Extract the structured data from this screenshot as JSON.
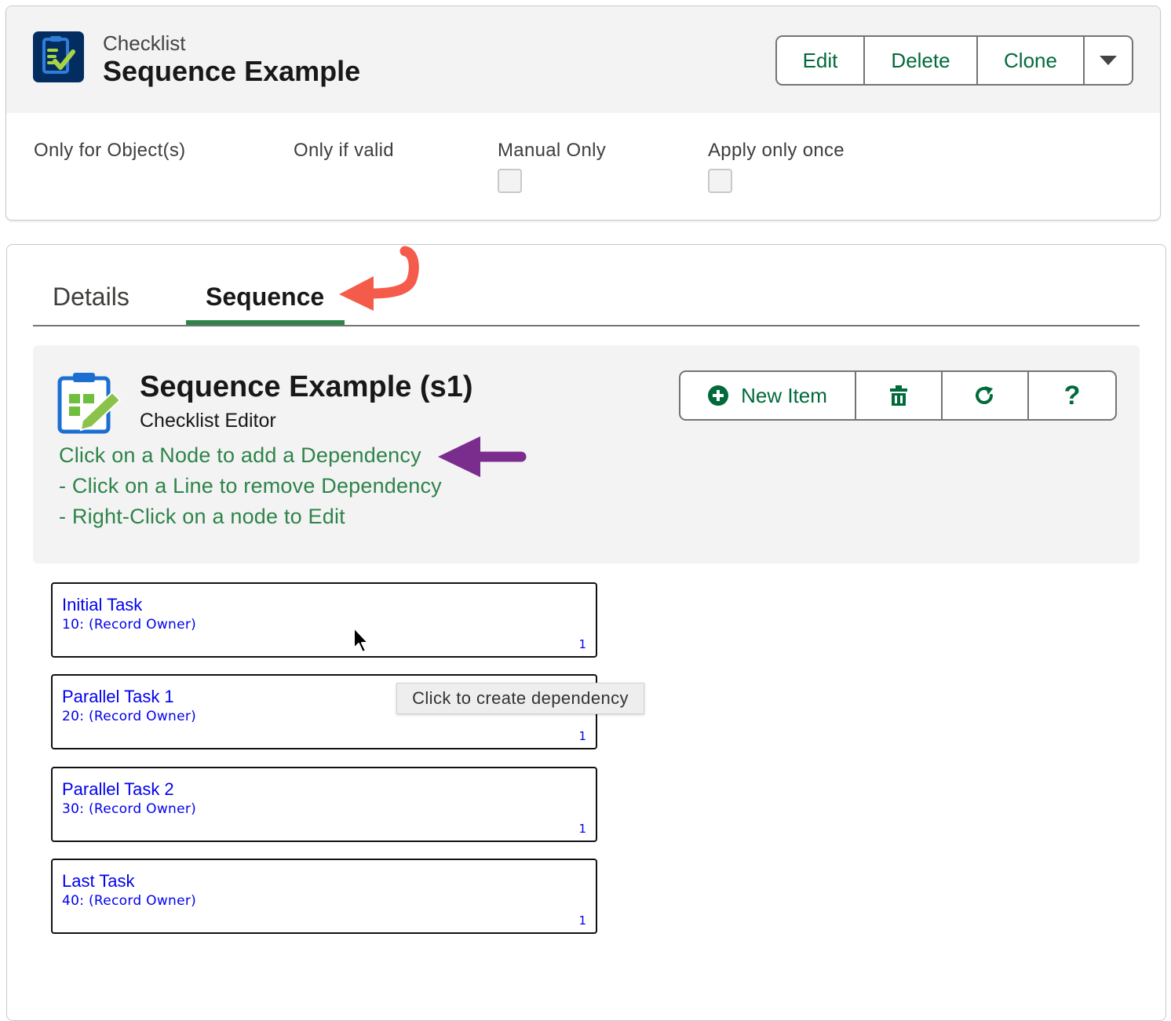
{
  "header": {
    "record_type": "Checklist",
    "record_title": "Sequence Example",
    "actions": {
      "edit": "Edit",
      "delete": "Delete",
      "clone": "Clone"
    }
  },
  "fields": {
    "only_for_objects": "Only for Object(s)",
    "only_if_valid": "Only if valid",
    "manual_only": {
      "label": "Manual Only",
      "checked": false
    },
    "apply_only_once": {
      "label": "Apply only once",
      "checked": false
    }
  },
  "tabs": [
    {
      "label": "Details",
      "active": false
    },
    {
      "label": "Sequence",
      "active": true
    }
  ],
  "editor": {
    "title": "Sequence Example (s1)",
    "subtitle": "Checklist Editor",
    "hints": [
      "Click on a Node to add a Dependency",
      "- Click on a Line to remove Dependency",
      "- Right-Click on a node to Edit"
    ],
    "toolbar": {
      "new_item": "New Item",
      "help": "?"
    }
  },
  "nodes": [
    {
      "title": "Initial Task",
      "subtitle": "10: (Record Owner)",
      "count": "1"
    },
    {
      "title": "Parallel Task 1",
      "subtitle": "20: (Record Owner)",
      "count": "1"
    },
    {
      "title": "Parallel Task 2",
      "subtitle": "30: (Record Owner)",
      "count": "1"
    },
    {
      "title": "Last Task",
      "subtitle": "40: (Record Owner)",
      "count": "1"
    }
  ],
  "tooltip": "Click to create dependency",
  "colors": {
    "brand_green": "#016a3a",
    "hint_green": "#2e844a",
    "node_link": "#0000ee",
    "icon_navy": "#032d60",
    "annotation_red": "#f45b4b",
    "annotation_purple": "#7b2d8e"
  },
  "icons": {
    "record_icon": "checklist-icon",
    "editor_icon": "clipboard-edit-icon",
    "more_actions": "chevron-down-icon",
    "new_item": "add-icon",
    "delete": "trash-icon",
    "refresh": "refresh-icon",
    "help": "help-icon"
  }
}
